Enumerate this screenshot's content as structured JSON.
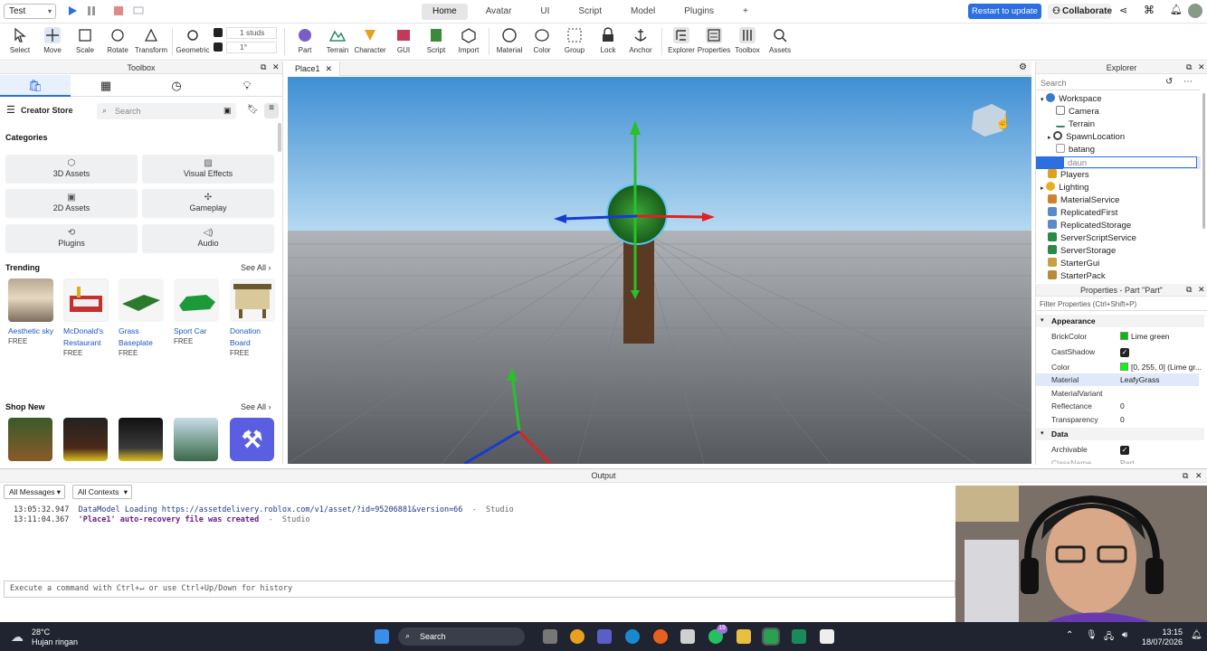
{
  "topbar": {
    "mode": "Test",
    "tabs": [
      "Home",
      "Avatar",
      "UI",
      "Script",
      "Model",
      "Plugins",
      "+"
    ],
    "active_tab": "Home",
    "restart_label": "Restart to update",
    "collaborate_label": "Collaborate"
  },
  "ribbon": {
    "tools": [
      "Select",
      "Move",
      "Scale",
      "Rotate",
      "Transform",
      "Geometric",
      "Part",
      "Terrain",
      "Character",
      "GUI",
      "Script",
      "Import",
      "Material",
      "Color",
      "Group",
      "Lock",
      "Anchor",
      "Explorer",
      "Properties",
      "Toolbox",
      "Assets"
    ],
    "studs_label": "1 studs",
    "degrees_label": "1°"
  },
  "toolbox": {
    "title": "Toolbox",
    "store_label": "Creator Store",
    "search_placeholder": "Search",
    "categories_label": "Categories",
    "categories": [
      {
        "name": "3D Assets",
        "icon": "⬡"
      },
      {
        "name": "Visual Effects",
        "icon": "▨"
      },
      {
        "name": "2D Assets",
        "icon": "▣"
      },
      {
        "name": "Gameplay",
        "icon": "✣"
      },
      {
        "name": "Plugins",
        "icon": "⟲"
      },
      {
        "name": "Audio",
        "icon": "◁)"
      }
    ],
    "trending_label": "Trending",
    "see_all": "See All",
    "trending": [
      {
        "name": "Aesthetic sky",
        "price": "FREE"
      },
      {
        "name": "McDonald's Restaurant",
        "price": "FREE"
      },
      {
        "name": "Grass Baseplate",
        "price": "FREE"
      },
      {
        "name": "Sport Car",
        "price": "FREE"
      },
      {
        "name": "Donation Board",
        "price": "FREE"
      }
    ],
    "shop_new_label": "Shop New",
    "shop_new_see_all": "See All"
  },
  "viewport": {
    "tab_label": "Place1"
  },
  "explorer": {
    "title": "Explorer",
    "search_placeholder": "Search",
    "items": [
      "Workspace",
      "Camera",
      "Terrain",
      "SpawnLocation",
      "batang",
      "daun",
      "Players",
      "Lighting",
      "MaterialService",
      "ReplicatedFirst",
      "ReplicatedStorage",
      "ServerScriptService",
      "ServerStorage",
      "StarterGui",
      "StarterPack"
    ]
  },
  "properties": {
    "title": "Properties - Part \"Part\"",
    "filter_placeholder": "Filter Properties (Ctrl+Shift+P)",
    "sections": {
      "appearance": "Appearance",
      "data": "Data"
    },
    "rows": [
      {
        "k": "BrickColor",
        "v": "Lime green"
      },
      {
        "k": "CastShadow",
        "v": ""
      },
      {
        "k": "Color",
        "v": "[0, 255, 0] (Lime gr..."
      },
      {
        "k": "Material",
        "v": "LeafyGrass"
      },
      {
        "k": "MaterialVariant",
        "v": ""
      },
      {
        "k": "Reflectance",
        "v": "0"
      },
      {
        "k": "Transparency",
        "v": "0"
      }
    ],
    "data_rows": [
      {
        "k": "Archivable",
        "v": ""
      },
      {
        "k": "ClassName",
        "v": "Part"
      }
    ],
    "colors": {
      "lime": "#00ff00"
    }
  },
  "output": {
    "title": "Output",
    "filter_messages": "All Messages",
    "filter_contexts": "All Contexts",
    "logs": [
      {
        "time": "13:05:32.947",
        "msg": "DataModel Loading https://assetdelivery.roblox.com/v1/asset/?id=95206881&version=66",
        "src": "-  Studio"
      },
      {
        "time": "13:11:04.367",
        "msg": "'Place1' auto-recovery file was created",
        "src": "-  Studio"
      }
    ],
    "command_placeholder": "Execute a command with Ctrl+↵ or use Ctrl+Up/Down for history"
  },
  "taskbar": {
    "temp": "28°C",
    "weather": "Hujan ringan",
    "search": "Search",
    "time": "13:15",
    "date": "18/07/2026",
    "badge": "19"
  }
}
